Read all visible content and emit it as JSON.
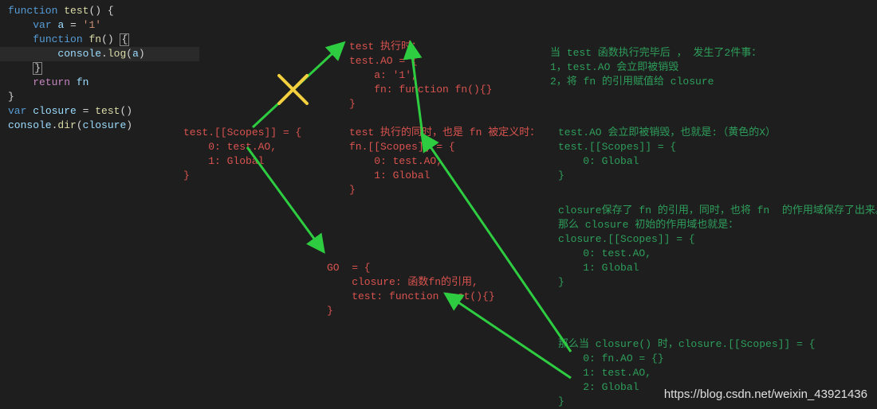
{
  "code": {
    "l1_kw1": "function",
    "l1_fn": "test",
    "l1_p": "() {",
    "l2_kw": "var",
    "l2_id": "a",
    "l2_eq": " = ",
    "l2_str": "'1'",
    "l3_kw": "function",
    "l3_fn": "fn",
    "l3_p": "() ",
    "l3_brace": "{",
    "l4_obj": "console",
    "l4_dot": ".",
    "l4_m": "log",
    "l4_p": "(",
    "l4_id": "a",
    "l4_p2": ")",
    "l5_brace": "}",
    "l6_kw": "return",
    "l6_id": "fn",
    "l7": "}",
    "l8_kw": "var",
    "l8_id": "closure",
    "l8_eq": " = ",
    "l8_fn": "test",
    "l8_p": "()",
    "l9_obj": "console",
    "l9_dot": ".",
    "l9_m": "dir",
    "l9_p": "(",
    "l9_id": "closure",
    "l9_p2": ")"
  },
  "red1": {
    "l1": "test.[[Scopes]] = {",
    "l2": "    0: test.AO,",
    "l3": "    1: Global",
    "l4": "}"
  },
  "red2": {
    "l1": "test 执行时：",
    "l2": "test.AO = {",
    "l3": "    a: '1',",
    "l4": "    fn: function fn(){}",
    "l5": "}"
  },
  "red3": {
    "l1": "test 执行的同时，也是 fn 被定义时：",
    "l2": "fn.[[Scopes]] = {",
    "l3": "    0: test.AO,",
    "l4": "    1: Global",
    "l5": "}"
  },
  "red4": {
    "l1": "GO  = {",
    "l2": "    closure: 函数fn的引用,",
    "l3": "    test: function test(){}",
    "l4": "}"
  },
  "green1": {
    "l1": "当 test 函数执行完毕后 ， 发生了2件事：",
    "l2": "1，test.AO 会立即被销毁",
    "l3": "2，将 fn 的引用赋值给 closure"
  },
  "green2": {
    "l1": "test.AO 会立即被销毁，也就是:（黄色的X）",
    "l2": "test.[[Scopes]] = {",
    "l3": "    0: Global",
    "l4": "}"
  },
  "green3": {
    "l1": "closure保存了 fn 的引用，同时，也将 fn  的作用域保存了出来。",
    "l2": "那么 closure 初始的作用域也就是：",
    "l3": "closure.[[Scopes]] = {",
    "l4": "    0: test.AO,",
    "l5": "    1: Global",
    "l6": "}"
  },
  "green4": {
    "l1": "那么当 closure() 时，closure.[[Scopes]] = {",
    "l2": "    0: fn.AO = {}",
    "l3": "    1: test.AO,",
    "l4": "    2: Global",
    "l5": "}"
  },
  "watermark": "https://blog.csdn.net/weixin_43921436"
}
